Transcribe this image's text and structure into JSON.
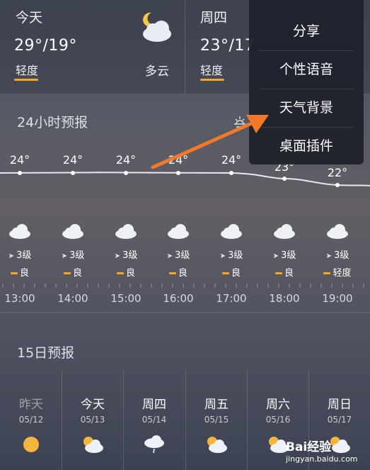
{
  "top_cards": [
    {
      "day": "今天",
      "temp": "29°/19°",
      "aqi": "轻度",
      "condition": "多云"
    },
    {
      "day": "周四",
      "temp": "23°/17",
      "aqi": "轻度"
    }
  ],
  "hourly": {
    "title": "24小时预报",
    "temps": [
      "24°",
      "24°",
      "24°",
      "24°",
      "24°",
      "23°",
      "22°"
    ],
    "winds": [
      "3级",
      "3级",
      "3级",
      "3级",
      "3级",
      "3级",
      "3级"
    ],
    "quality": [
      "良",
      "良",
      "良",
      "良",
      "良",
      "良",
      "轻度"
    ],
    "times": [
      "13:00",
      "14:00",
      "15:00",
      "16:00",
      "17:00",
      "18:00",
      "19:00"
    ]
  },
  "daily": {
    "title": "15日预报",
    "days": [
      {
        "name": "昨天",
        "date": "05/12"
      },
      {
        "name": "今天",
        "date": "05/13"
      },
      {
        "name": "周四",
        "date": "05/14"
      },
      {
        "name": "周五",
        "date": "05/15"
      },
      {
        "name": "周六",
        "date": "05/16"
      },
      {
        "name": "周日",
        "date": "05/17"
      }
    ]
  },
  "menu": {
    "items": [
      "分享",
      "个性语音",
      "天气背景",
      "桌面插件"
    ]
  },
  "watermark": {
    "brand": "Bai经验",
    "url": "jingyan.baidu.com"
  },
  "colors": {
    "accent": "#f5a623",
    "arrow": "#f07a2a",
    "menu_bg": "#1e202a"
  }
}
